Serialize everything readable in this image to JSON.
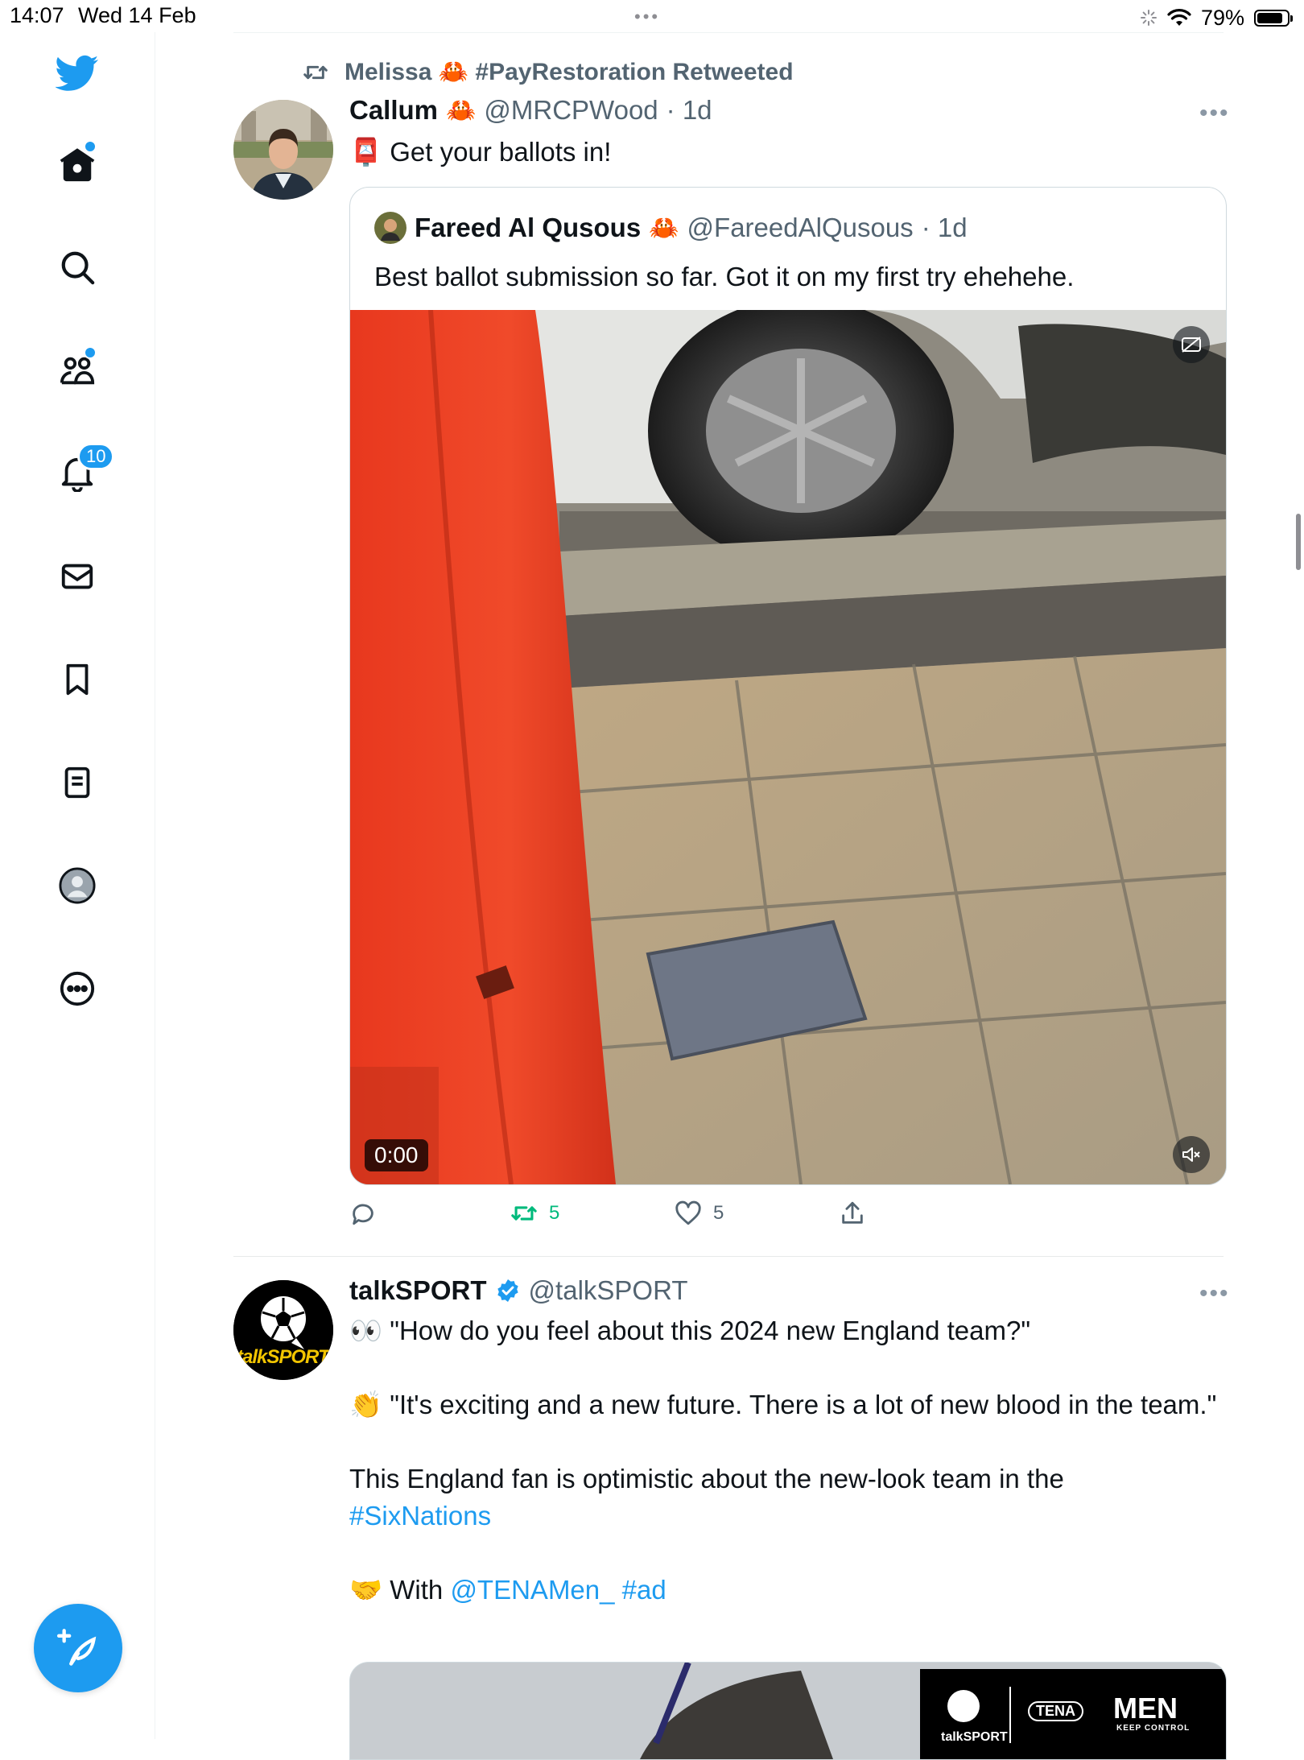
{
  "status_bar": {
    "time": "14:07",
    "date": "Wed 14 Feb",
    "dots": "•••",
    "battery": "79%",
    "battery_level": 0.79
  },
  "sidebar": {
    "notifications_badge": "10",
    "items": [
      "twitter-logo-icon",
      "home-icon",
      "search-icon",
      "communities-icon",
      "notifications-icon",
      "messages-icon",
      "bookmarks-icon",
      "lists-icon",
      "profile-icon",
      "more-icon"
    ]
  },
  "tweet1": {
    "retweeted_by": "Melissa 🦀 #PayRestoration Retweeted",
    "author_name": "Callum",
    "author_emoji": "🦀",
    "handle": "@MRCPWood",
    "time": "· 1d",
    "text": "📮 Get your ballots in!",
    "quote": {
      "author_name": "Fareed Al Qusous",
      "author_emoji": "🦀",
      "handle": "@FareedAlQusous",
      "time": "· 1d",
      "text": "Best ballot submission so far. Got it on my first try ehehehe.",
      "video_time": "0:00"
    },
    "actions": {
      "retweets": "5",
      "likes": "5"
    }
  },
  "tweet2": {
    "author_name": "talkSPORT",
    "handle": "@talkSPORT",
    "line1": "👀 \"How do you feel about this 2024 new England team?\"",
    "line2": "👏 \"It's exciting and a new future. There is a lot of new blood in the team.\"",
    "line3": "This England fan is optimistic about the new-look team in the",
    "hashtag": "#SixNations",
    "with_prefix": "🤝 With",
    "mention": "@TENAMen_",
    "ad_tag": "#ad",
    "avatar_text": "talkSPORT",
    "media_logo_left": "talkSPORT",
    "media_logo_tena": "TENA",
    "media_logo_men": "MEN",
    "media_logo_tagline": "KEEP CONTROL"
  },
  "colors": {
    "accent": "#1d9bf0",
    "retweet_green": "#00ba7c",
    "secondary_text": "#536471"
  }
}
